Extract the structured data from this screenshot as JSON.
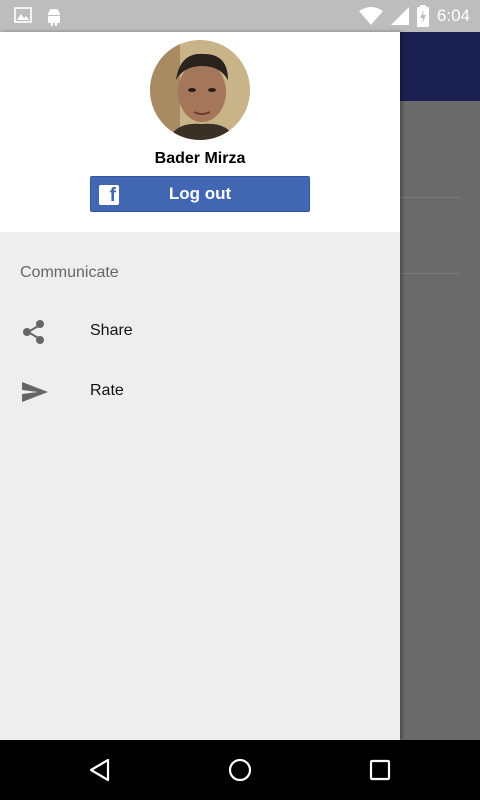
{
  "status_bar": {
    "time": "6:04",
    "icons": [
      "image-icon",
      "android-icon",
      "wifi-icon",
      "signal-icon",
      "battery-charging-icon"
    ]
  },
  "drawer": {
    "user": {
      "name": "Bader Mirza"
    },
    "facebook_button": {
      "label": "Log out",
      "icon": "facebook-icon",
      "color": "#4267b2"
    },
    "section_title": "Communicate",
    "items": [
      {
        "label": "Share",
        "icon": "share-icon"
      },
      {
        "label": "Rate",
        "icon": "send-icon"
      }
    ]
  },
  "app": {
    "toolbar_color": "#1a2150"
  },
  "nav_bar": {
    "buttons": [
      "back-icon",
      "home-icon",
      "recents-icon"
    ]
  }
}
